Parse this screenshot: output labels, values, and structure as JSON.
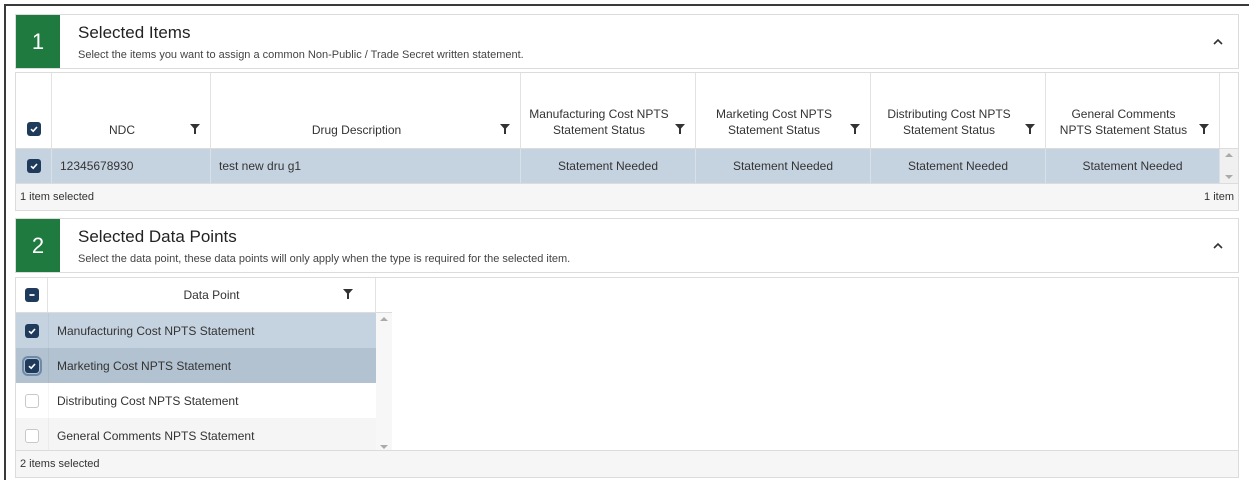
{
  "section1": {
    "number": "1",
    "title": "Selected Items",
    "subtitle": "Select the items you want to assign a common Non-Public / Trade Secret written statement."
  },
  "items_table": {
    "columns": [
      "NDC",
      "Drug Description",
      "Manufacturing Cost NPTS Statement Status",
      "Marketing Cost NPTS Statement Status",
      "Distributing Cost NPTS Statement Status",
      "General Comments NPTS Statement Status"
    ],
    "rows": [
      {
        "ndc": "12345678930",
        "description": "test new dru g1",
        "manufacturing": "Statement Needed",
        "marketing": "Statement Needed",
        "distributing": "Statement Needed",
        "general": "Statement Needed"
      }
    ],
    "footer_left": "1 item selected",
    "footer_right": "1 item"
  },
  "section2": {
    "number": "2",
    "title": "Selected Data Points",
    "subtitle": "Select the data point, these data points will only apply when the type is required for the selected item."
  },
  "datapoints_table": {
    "column": "Data Point",
    "rows": [
      {
        "label": "Manufacturing Cost NPTS Statement",
        "checked": true
      },
      {
        "label": "Marketing Cost NPTS Statement",
        "checked": true
      },
      {
        "label": "Distributing Cost NPTS Statement",
        "checked": false
      },
      {
        "label": "General Comments NPTS Statement",
        "checked": false
      }
    ],
    "footer": "2 items selected"
  },
  "colors": {
    "badge": "#1e7a3f",
    "selected_row": "#c5d3e0",
    "checkbox": "#1f3b5c"
  },
  "icons": {
    "collapse": "chevron-up-icon",
    "filter": "filter-icon",
    "check": "check-icon"
  }
}
